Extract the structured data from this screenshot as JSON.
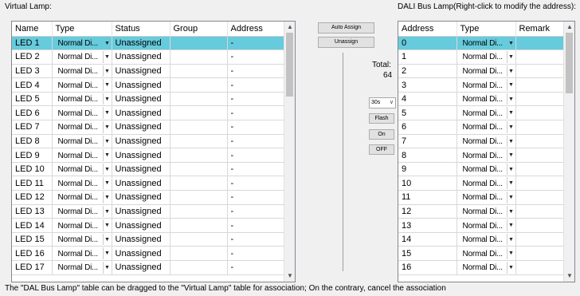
{
  "virtual": {
    "caption": "Virtual Lamp:",
    "headers": [
      "Name",
      "Type",
      "Status",
      "Group",
      "Address"
    ],
    "rows": [
      {
        "name": "LED 1",
        "type": "Normal Di...",
        "status": "Unassigned",
        "group": "",
        "address": "-"
      },
      {
        "name": "LED 2",
        "type": "Normal Di...",
        "status": "Unassigned",
        "group": "",
        "address": "-"
      },
      {
        "name": "LED 3",
        "type": "Normal Di...",
        "status": "Unassigned",
        "group": "",
        "address": "-"
      },
      {
        "name": "LED 4",
        "type": "Normal Di...",
        "status": "Unassigned",
        "group": "",
        "address": "-"
      },
      {
        "name": "LED 5",
        "type": "Normal Di...",
        "status": "Unassigned",
        "group": "",
        "address": "-"
      },
      {
        "name": "LED 6",
        "type": "Normal Di...",
        "status": "Unassigned",
        "group": "",
        "address": "-"
      },
      {
        "name": "LED 7",
        "type": "Normal Di...",
        "status": "Unassigned",
        "group": "",
        "address": "-"
      },
      {
        "name": "LED 8",
        "type": "Normal Di...",
        "status": "Unassigned",
        "group": "",
        "address": "-"
      },
      {
        "name": "LED 9",
        "type": "Normal Di...",
        "status": "Unassigned",
        "group": "",
        "address": "-"
      },
      {
        "name": "LED 10",
        "type": "Normal Di...",
        "status": "Unassigned",
        "group": "",
        "address": "-"
      },
      {
        "name": "LED 11",
        "type": "Normal Di...",
        "status": "Unassigned",
        "group": "",
        "address": "-"
      },
      {
        "name": "LED 12",
        "type": "Normal Di...",
        "status": "Unassigned",
        "group": "",
        "address": "-"
      },
      {
        "name": "LED 13",
        "type": "Normal Di...",
        "status": "Unassigned",
        "group": "",
        "address": "-"
      },
      {
        "name": "LED 14",
        "type": "Normal Di...",
        "status": "Unassigned",
        "group": "",
        "address": "-"
      },
      {
        "name": "LED 15",
        "type": "Normal Di...",
        "status": "Unassigned",
        "group": "",
        "address": "-"
      },
      {
        "name": "LED 16",
        "type": "Normal Di...",
        "status": "Unassigned",
        "group": "",
        "address": "-"
      },
      {
        "name": "LED 17",
        "type": "Normal Di...",
        "status": "Unassigned",
        "group": "",
        "address": "-"
      }
    ]
  },
  "dali": {
    "caption": "DALI Bus Lamp(Right-click to modify the address):",
    "headers": [
      "Address",
      "Type",
      "Remark"
    ],
    "rows": [
      {
        "address": "0",
        "type": "Normal Di...",
        "remark": ""
      },
      {
        "address": "1",
        "type": "Normal Di...",
        "remark": ""
      },
      {
        "address": "2",
        "type": "Normal Di...",
        "remark": ""
      },
      {
        "address": "3",
        "type": "Normal Di...",
        "remark": ""
      },
      {
        "address": "4",
        "type": "Normal Di...",
        "remark": ""
      },
      {
        "address": "5",
        "type": "Normal Di...",
        "remark": ""
      },
      {
        "address": "6",
        "type": "Normal Di...",
        "remark": ""
      },
      {
        "address": "7",
        "type": "Normal Di...",
        "remark": ""
      },
      {
        "address": "8",
        "type": "Normal Di...",
        "remark": ""
      },
      {
        "address": "9",
        "type": "Normal Di...",
        "remark": ""
      },
      {
        "address": "10",
        "type": "Normal Di...",
        "remark": ""
      },
      {
        "address": "11",
        "type": "Normal Di...",
        "remark": ""
      },
      {
        "address": "12",
        "type": "Normal Di...",
        "remark": ""
      },
      {
        "address": "13",
        "type": "Normal Di...",
        "remark": ""
      },
      {
        "address": "14",
        "type": "Normal Di...",
        "remark": ""
      },
      {
        "address": "15",
        "type": "Normal Di...",
        "remark": ""
      },
      {
        "address": "16",
        "type": "Normal Di...",
        "remark": ""
      }
    ]
  },
  "controls": {
    "auto_assign": "Auto Assign",
    "unassign": "Unassign",
    "total_label": "Total:",
    "total_value": "64",
    "interval": "30s",
    "flash": "Flash",
    "on": "On",
    "off": "OFF"
  },
  "footer": "The \"DAL Bus Lamp\" table can be dragged to the \"Virtual Lamp\" table for association;  On the contrary, cancel the association",
  "colors": {
    "selected_row": "#66cbdc"
  },
  "icons": {
    "dropdown": "triangle-down-icon",
    "scroll_up": "scroll-up-icon",
    "scroll_down": "scroll-down-icon",
    "select_chevron": "chevron-down-icon"
  }
}
